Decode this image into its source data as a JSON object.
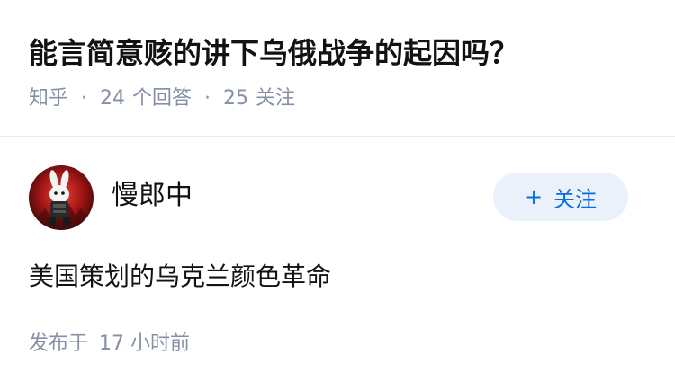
{
  "question": {
    "title": "能言简意赅的讲下乌俄战争的起因吗？",
    "source": "知乎",
    "answer_count": "24",
    "answer_label": "个回答",
    "follower_count": "25",
    "follower_label": "关注"
  },
  "answer": {
    "author_name": "慢郎中",
    "avatar_icon": "rabbit-avatar-icon",
    "follow_button": {
      "icon": "plus-icon",
      "plus": "+",
      "label": "关注"
    },
    "content": "美国策划的乌克兰颜色革命",
    "published_label": "发布于",
    "published_time": "17 小时前"
  },
  "colors": {
    "text": "#121212",
    "meta": "#8590a6",
    "accent": "#056de8",
    "button_bg": "#ebf1fa"
  }
}
